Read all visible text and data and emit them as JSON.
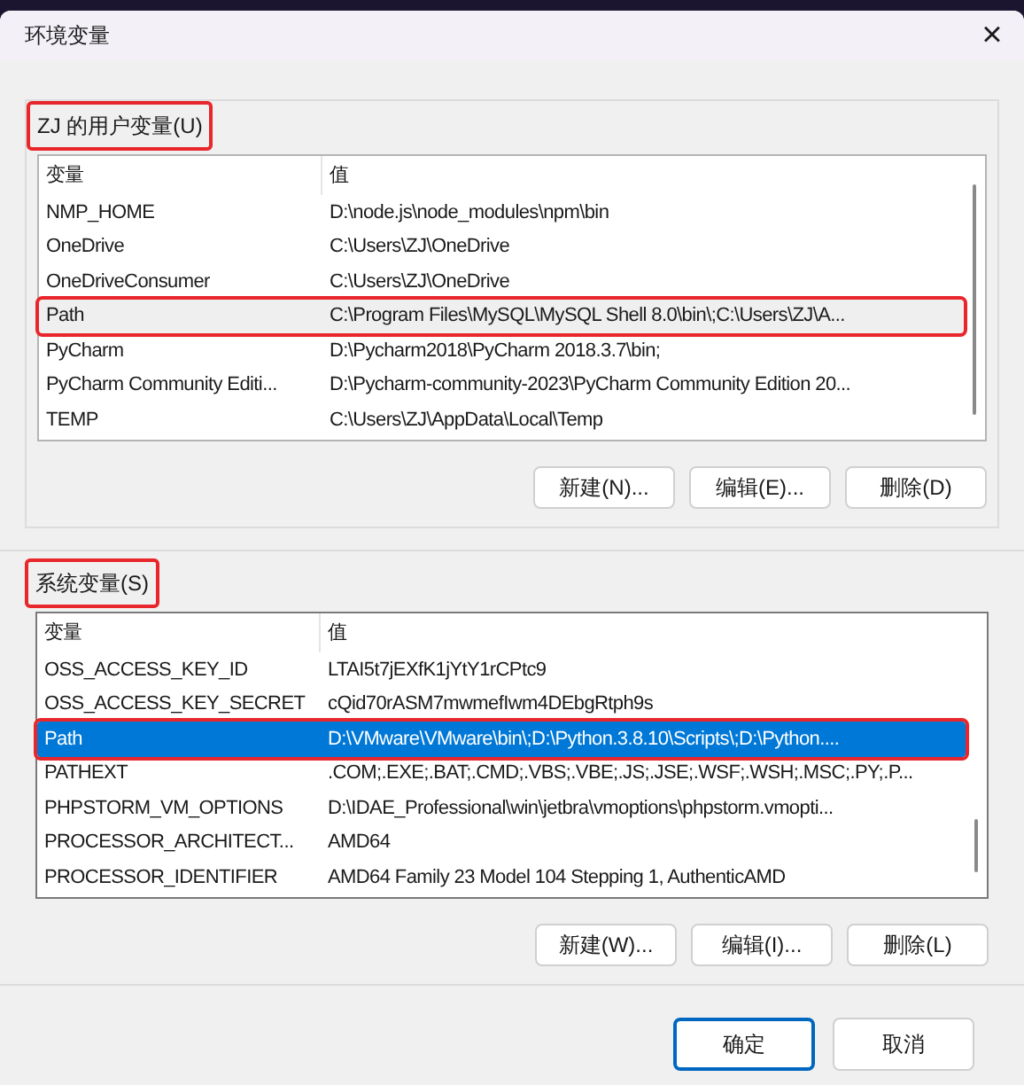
{
  "window": {
    "title": "环境变量",
    "close": "×"
  },
  "groups": [
    {
      "title": "ZJ 的用户变量(U)",
      "annotated": true,
      "focused": false,
      "columns": [
        "变量",
        "值"
      ],
      "rows": [
        {
          "name": "NMP_HOME",
          "value": "D:\\node.js\\node_modules\\npm\\bin",
          "selected": false,
          "annotated": false
        },
        {
          "name": "OneDrive",
          "value": "C:\\Users\\ZJ\\OneDrive",
          "selected": false,
          "annotated": false
        },
        {
          "name": "OneDriveConsumer",
          "value": "C:\\Users\\ZJ\\OneDrive",
          "selected": false,
          "annotated": false
        },
        {
          "name": "Path",
          "value": "C:\\Program Files\\MySQL\\MySQL Shell 8.0\\bin\\;C:\\Users\\ZJ\\A...",
          "selected": true,
          "annotated": true
        },
        {
          "name": "PyCharm",
          "value": "D:\\Pycharm2018\\PyCharm 2018.3.7\\bin;",
          "selected": false,
          "annotated": false
        },
        {
          "name": "PyCharm Community Editi...",
          "value": "D:\\Pycharm-community-2023\\PyCharm Community Edition 20...",
          "selected": false,
          "annotated": false
        },
        {
          "name": "TEMP",
          "value": "C:\\Users\\ZJ\\AppData\\Local\\Temp",
          "selected": false,
          "annotated": false
        }
      ],
      "buttons": [
        "新建(N)...",
        "编辑(E)...",
        "删除(D)"
      ]
    },
    {
      "title": "系统变量(S)",
      "annotated": true,
      "focused": true,
      "columns": [
        "变量",
        "值"
      ],
      "rows": [
        {
          "name": "OSS_ACCESS_KEY_ID",
          "value": "LTAI5t7jEXfK1jYtY1rCPtc9",
          "selected": false,
          "annotated": false
        },
        {
          "name": "OSS_ACCESS_KEY_SECRET",
          "value": "cQid70rASM7mwmefIwm4DEbgRtph9s",
          "selected": false,
          "annotated": false
        },
        {
          "name": "Path",
          "value": "D:\\VMware\\VMware\\bin\\;D:\\Python.3.8.10\\Scripts\\;D:\\Python....",
          "selected": true,
          "annotated": true
        },
        {
          "name": "PATHEXT",
          "value": ".COM;.EXE;.BAT;.CMD;.VBS;.VBE;.JS;.JSE;.WSF;.WSH;.MSC;.PY;.P...",
          "selected": false,
          "annotated": false
        },
        {
          "name": "PHPSTORM_VM_OPTIONS",
          "value": "D:\\IDAE_Professional\\win\\jetbra\\vmoptions\\phpstorm.vmopti...",
          "selected": false,
          "annotated": false
        },
        {
          "name": "PROCESSOR_ARCHITECT...",
          "value": "AMD64",
          "selected": false,
          "annotated": false
        },
        {
          "name": "PROCESSOR_IDENTIFIER",
          "value": "AMD64 Family 23 Model 104 Stepping 1, AuthenticAMD",
          "selected": false,
          "annotated": false
        }
      ],
      "buttons": [
        "新建(W)...",
        "编辑(I)...",
        "删除(L)"
      ]
    }
  ],
  "footer_buttons": [
    {
      "label": "确定",
      "default": true
    },
    {
      "label": "取消",
      "default": false
    }
  ]
}
